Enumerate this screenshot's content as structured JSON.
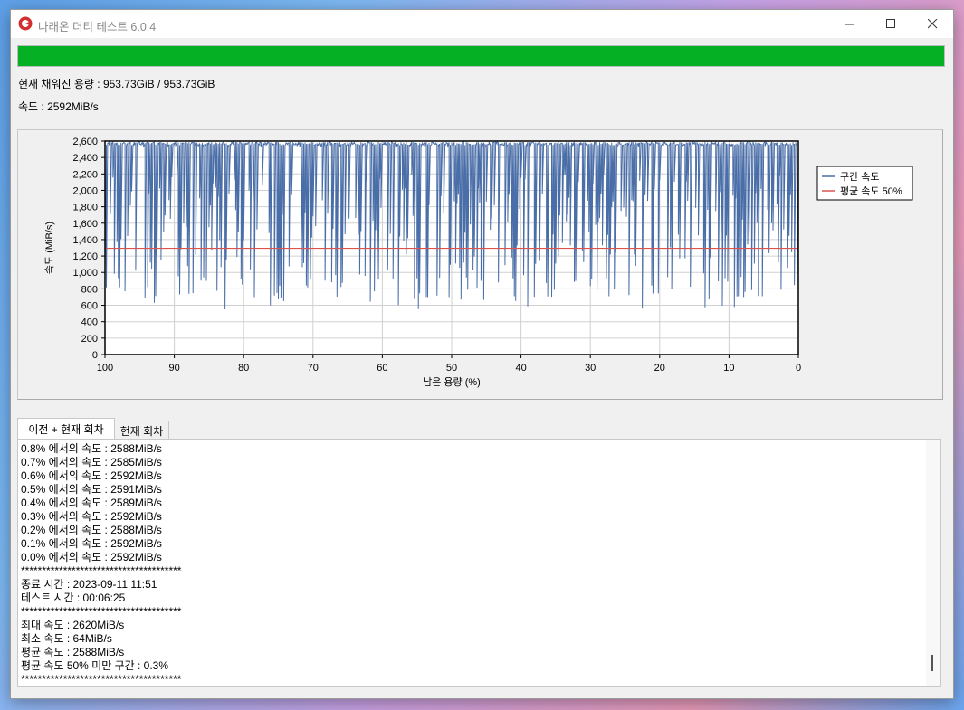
{
  "window": {
    "title": "나래온 더티 테스트 6.0.4"
  },
  "progress": {
    "fraction": 1.0,
    "color": "#06b025"
  },
  "info": {
    "filled_capacity": "현재 채워진 용량 : 953.73GiB / 953.73GiB",
    "speed": "속도 : 2592MiB/s"
  },
  "chart_data": {
    "type": "line",
    "xlabel": "남은 용량 (%)",
    "ylabel": "속도 (MiB/s)",
    "xlim": [
      100,
      0
    ],
    "ylim": [
      0,
      2600
    ],
    "xticks": [
      "100",
      "90",
      "80",
      "70",
      "60",
      "50",
      "40",
      "30",
      "20",
      "10",
      "0"
    ],
    "yticks": [
      "0",
      "200",
      "400",
      "600",
      "800",
      "1,000",
      "1,200",
      "1,400",
      "1,600",
      "1,800",
      "2,000",
      "2,200",
      "2,400",
      "2,600"
    ],
    "grid": true,
    "legend_position": "top-right",
    "series": [
      {
        "name": "구간 속도",
        "color": "#4a6ea8",
        "description_values": {
          "typical": 2590,
          "min_dip": 550
        }
      },
      {
        "name": "평균 속도 50%",
        "color": "#d9534f",
        "values": [
          1294,
          1294
        ]
      }
    ]
  },
  "tabs": [
    {
      "label": "이전 + 현재 회차",
      "active": true
    },
    {
      "label": "현재 회차",
      "active": false
    }
  ],
  "log": [
    "0.8% 에서의 속도 : 2588MiB/s",
    "0.7% 에서의 속도 : 2585MiB/s",
    "0.6% 에서의 속도 : 2592MiB/s",
    "0.5% 에서의 속도 : 2591MiB/s",
    "0.4% 에서의 속도 : 2589MiB/s",
    "0.3% 에서의 속도 : 2592MiB/s",
    "0.2% 에서의 속도 : 2588MiB/s",
    "0.1% 에서의 속도 : 2592MiB/s",
    "0.0% 에서의 속도 : 2592MiB/s",
    "**************************************",
    "종료 시간 : 2023-09-11 11:51",
    "테스트 시간 : 00:06:25",
    "**************************************",
    "최대 속도 : 2620MiB/s",
    "최소 속도 : 64MiB/s",
    "평균 속도 : 2588MiB/s",
    "평균 속도 50% 미만 구간 : 0.3%",
    "**************************************"
  ]
}
